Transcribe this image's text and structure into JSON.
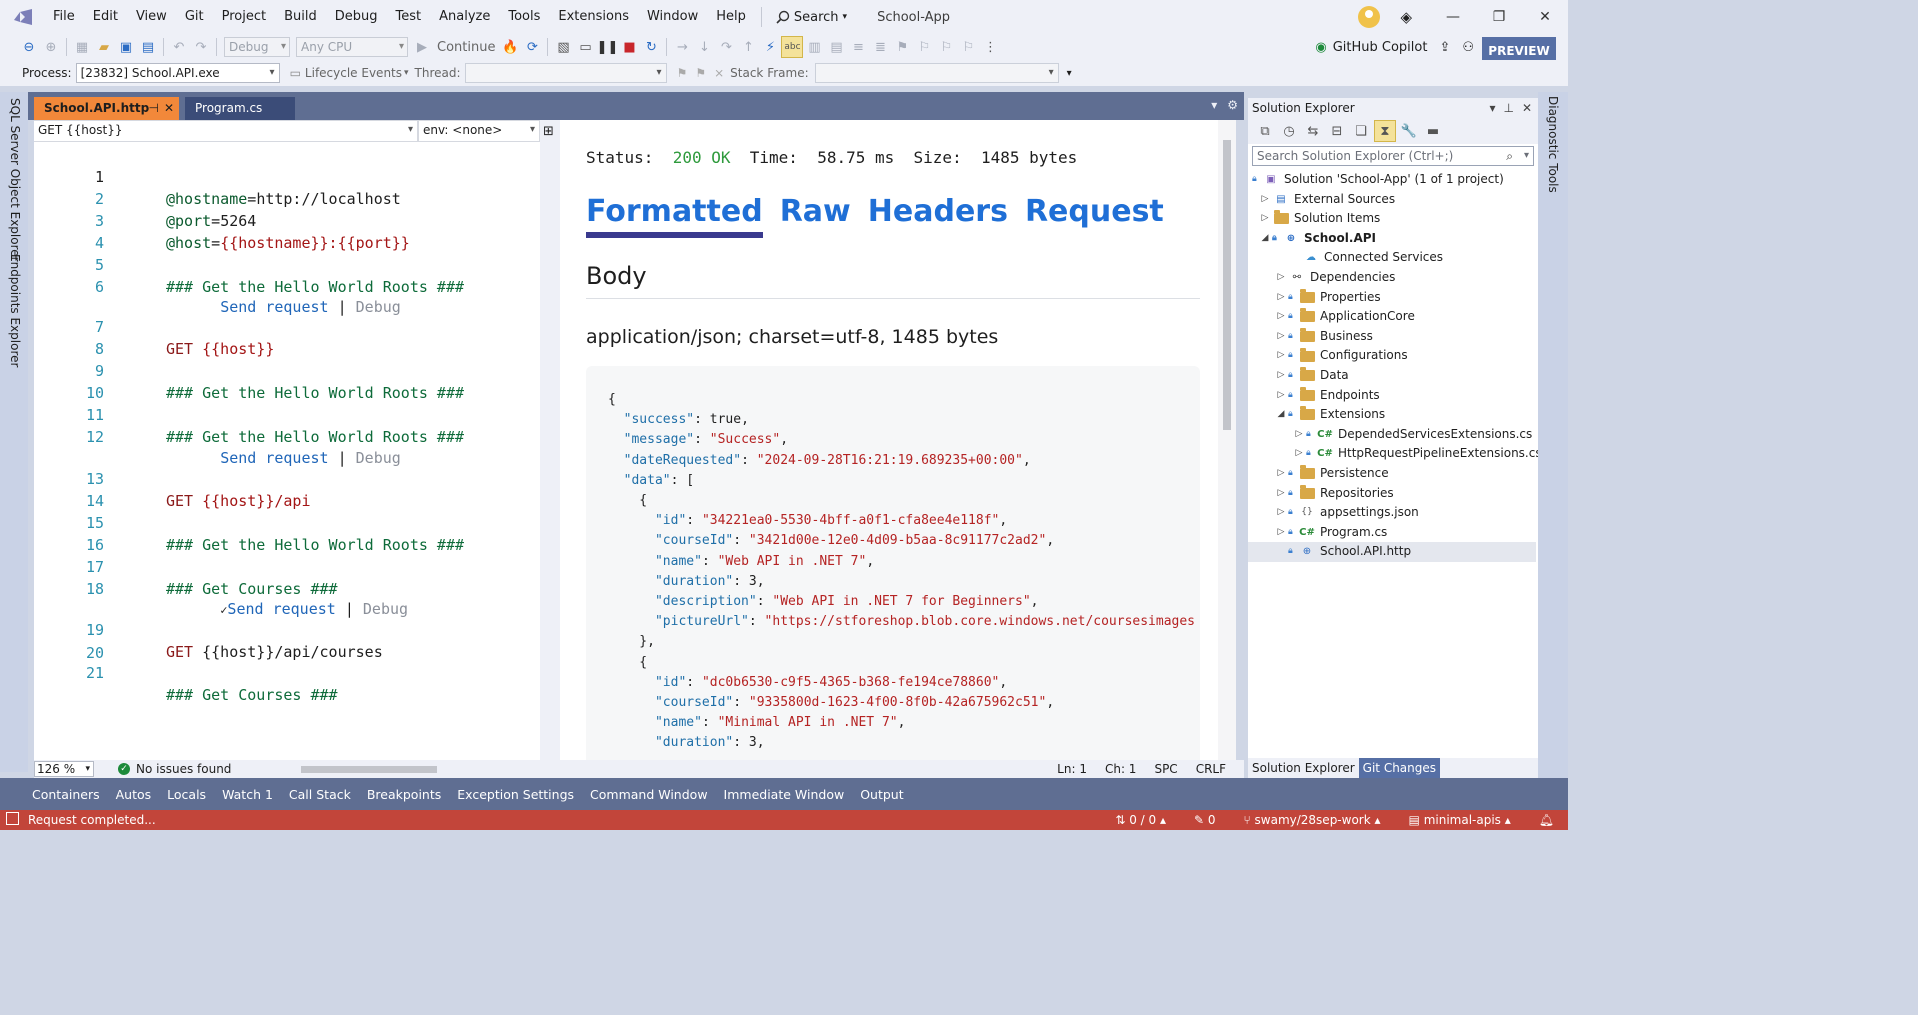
{
  "menubar": {
    "items": [
      "File",
      "Edit",
      "View",
      "Git",
      "Project",
      "Build",
      "Debug",
      "Test",
      "Analyze",
      "Tools",
      "Extensions",
      "Window",
      "Help"
    ],
    "search_label": "Search",
    "app_title": "School-App"
  },
  "toolbar": {
    "config": "Debug",
    "platform": "Any CPU",
    "continue_label": "Continue",
    "copilot_label": "GitHub Copilot",
    "preview_label": "PREVIEW"
  },
  "procbar": {
    "process_label": "Process:",
    "process_value": "[23832] School.API.exe",
    "lifecycle_label": "Lifecycle Events",
    "thread_label": "Thread:",
    "thread_value": "",
    "stackframe_label": "Stack Frame:",
    "stackframe_value": ""
  },
  "left_rail": {
    "tab1": "SQL Server Object Explorer",
    "tab2": "Endpoints Explorer"
  },
  "right_rail": {
    "tab1": "Diagnostic Tools"
  },
  "editor_tabs": {
    "active": "School.API.http",
    "other": "Program.cs"
  },
  "editor": {
    "nav_left": "GET {{host}}",
    "nav_env": "env: <none>",
    "lines": {
      "l1": {
        "n": "1",
        "var": "@hostname",
        "eq": "=",
        "val": "http://localhost"
      },
      "l2": {
        "n": "2",
        "var": "@port",
        "eq": "=",
        "val": "5264"
      },
      "l3": {
        "n": "3",
        "var": "@host",
        "eq": "=",
        "val": "{{hostname}}:{{port}}"
      },
      "l4": {
        "n": "4"
      },
      "l5": {
        "n": "5",
        "text": "### Get the Hello World Roots ###"
      },
      "l6": {
        "n": "6"
      },
      "l7": {
        "n": "7",
        "method": "GET",
        "url": " {{host}}"
      },
      "l8": {
        "n": "8"
      },
      "l9": {
        "n": "9",
        "text": "### Get the Hello World Roots ###"
      },
      "l10": {
        "n": "10"
      },
      "l11": {
        "n": "11",
        "text": "### Get the Hello World Roots ###"
      },
      "l12": {
        "n": "12"
      },
      "l13": {
        "n": "13",
        "method": "GET",
        "url": " {{host}}/api"
      },
      "l14": {
        "n": "14"
      },
      "l15": {
        "n": "15",
        "text": "### Get the Hello World Roots ###"
      },
      "l16": {
        "n": "16"
      },
      "l17": {
        "n": "17",
        "text": "### Get Courses ###"
      },
      "l18": {
        "n": "18"
      },
      "l19": {
        "n": "19",
        "method": "GET",
        "url": " {{host}}/api/courses"
      },
      "l20": {
        "n": "20"
      },
      "l21": {
        "n": "21",
        "text": "### Get Courses ###"
      }
    },
    "lens": {
      "send": "Send request",
      "pipe": " | ",
      "debug": "Debug",
      "check": "✓"
    }
  },
  "editor_status": {
    "zoom": "126 %",
    "issues": "No issues found",
    "ln": "Ln: 1",
    "ch": "Ch: 1",
    "spc": "SPC",
    "crlf": "CRLF"
  },
  "response": {
    "status_label": "Status:",
    "status_value": "200 OK",
    "time_label": "Time:",
    "time_value": "58.75 ms",
    "size_label": "Size:",
    "size_value": "1485 bytes",
    "tabs": [
      "Formatted",
      "Raw",
      "Headers",
      "Request"
    ],
    "body_heading": "Body",
    "content_type": "application/json; charset=utf-8, 1485 bytes",
    "json": {
      "success_key": "\"success\"",
      "success_val": "true",
      "message_key": "\"message\"",
      "message_val": "\"Success\"",
      "date_key": "\"dateRequested\"",
      "date_val": "\"2024-09-28T16:21:19.689235+00:00\"",
      "data_key": "\"data\"",
      "items": [
        {
          "id": "\"34221ea0-5530-4bff-a0f1-cfa8ee4e118f\"",
          "courseId": "\"3421d00e-12e0-4d09-b5aa-8c91177c2ad2\"",
          "name": "\"Web API in .NET 7\"",
          "duration": "3",
          "description": "\"Web API in .NET 7 for Beginners\"",
          "pictureUrl": "\"https://stforeshop.blob.core.windows.net/coursesimages"
        },
        {
          "id": "\"dc0b6530-c9f5-4365-b368-fe194ce78860\"",
          "courseId": "\"9335800d-1623-4f00-8f0b-42a675962c51\"",
          "name": "\"Minimal API in .NET 7\"",
          "duration": "3"
        }
      ]
    }
  },
  "solution_explorer": {
    "title": "Solution Explorer",
    "search_placeholder": "Search Solution Explorer (Ctrl+;)",
    "nodes": [
      "Solution 'School-App' (1 of 1 project)",
      "External Sources",
      "Solution Items",
      "School.API",
      "Connected Services",
      "Dependencies",
      "Properties",
      "ApplicationCore",
      "Business",
      "Configurations",
      "Data",
      "Endpoints",
      "Extensions",
      "DependedServicesExtensions.cs",
      "HttpRequestPipelineExtensions.cs",
      "Persistence",
      "Repositories",
      "appsettings.json",
      "Program.cs",
      "School.API.http"
    ],
    "bottom_tabs": [
      "Solution Explorer",
      "Git Changes"
    ]
  },
  "tool_tabs": [
    "Containers",
    "Autos",
    "Locals",
    "Watch 1",
    "Call Stack",
    "Breakpoints",
    "Exception Settings",
    "Command Window",
    "Immediate Window",
    "Output"
  ],
  "statusbar": {
    "message": "Request completed...",
    "sync": "0 / 0",
    "edits": "0",
    "branch": "swamy/28sep-work",
    "repo": "minimal-apis"
  },
  "colors": {
    "accent_tab": "#f2883a",
    "statusbar": "#c2453a",
    "link_blue": "#1f6fd6",
    "ok_green": "#2e9a3c"
  }
}
